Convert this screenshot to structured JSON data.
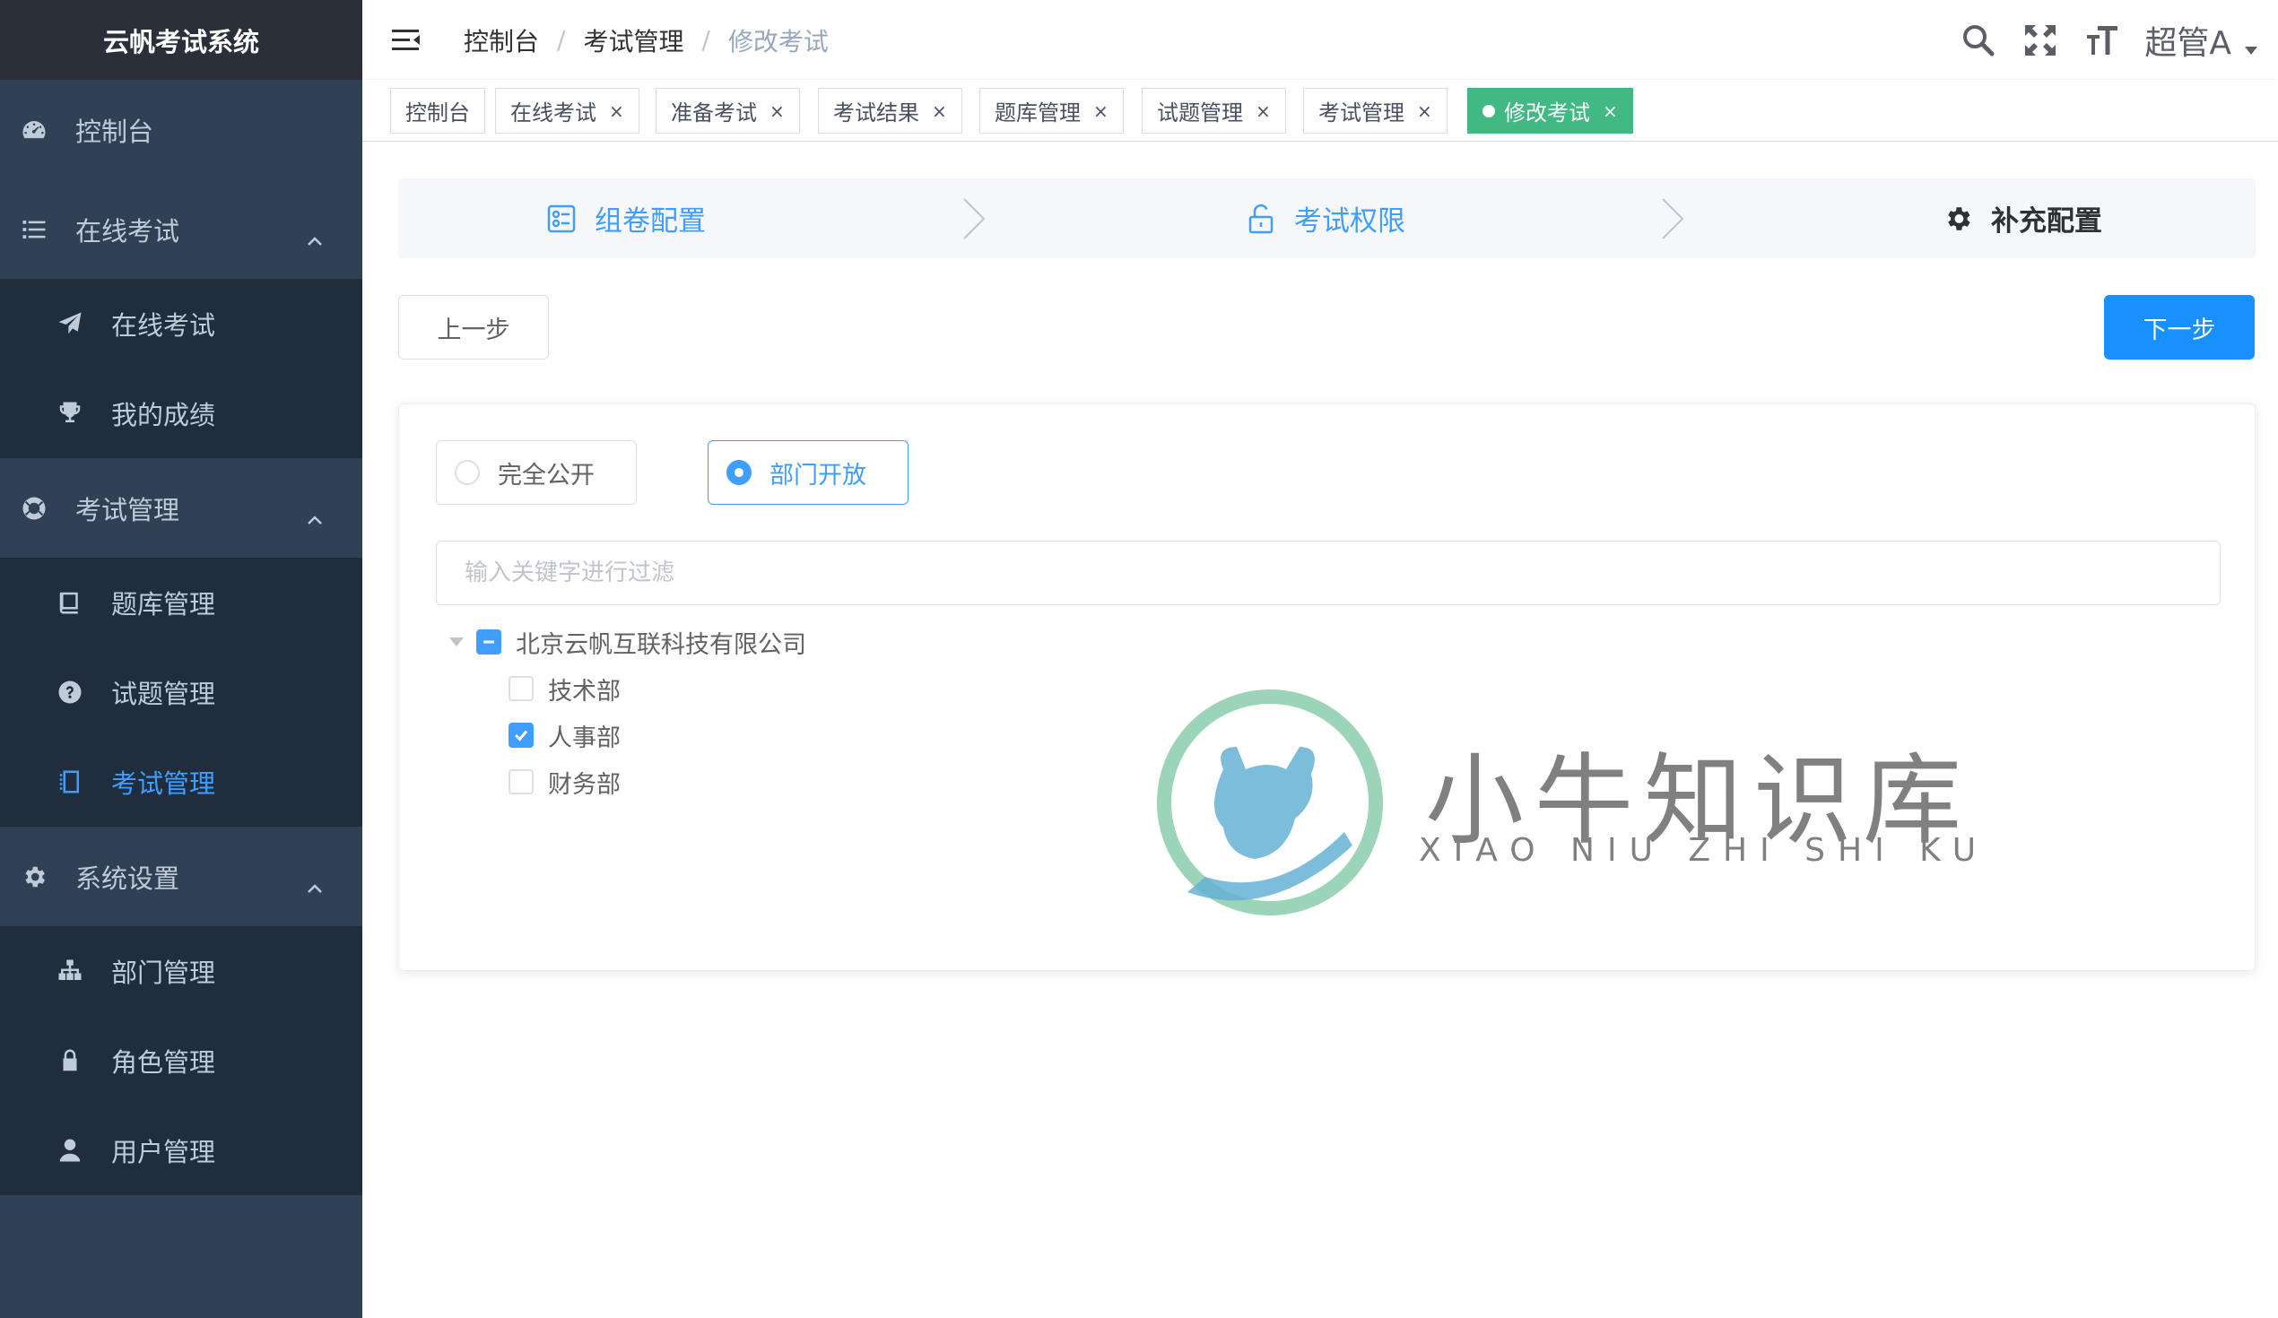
{
  "app": {
    "title": "云帆考试系统"
  },
  "sidebar": {
    "items": [
      {
        "label": "控制台",
        "icon": "dashboard-icon"
      },
      {
        "label": "在线考试",
        "icon": "list-icon"
      },
      {
        "label": "在线考试",
        "icon": "paper-plane-icon"
      },
      {
        "label": "我的成绩",
        "icon": "trophy-icon"
      },
      {
        "label": "考试管理",
        "icon": "lifebuoy-icon"
      },
      {
        "label": "题库管理",
        "icon": "book-icon"
      },
      {
        "label": "试题管理",
        "icon": "question-circle-icon"
      },
      {
        "label": "考试管理",
        "icon": "notebook-icon"
      },
      {
        "label": "系统设置",
        "icon": "gear-icon"
      },
      {
        "label": "部门管理",
        "icon": "sitemap-icon"
      },
      {
        "label": "角色管理",
        "icon": "lock-icon"
      },
      {
        "label": "用户管理",
        "icon": "user-icon"
      }
    ],
    "active_index": 7
  },
  "header": {
    "breadcrumb": [
      "控制台",
      "考试管理",
      "修改考试"
    ],
    "breadcrumb_separator": "/",
    "user_name": "超管A"
  },
  "tags": [
    {
      "label": "控制台",
      "closable": false
    },
    {
      "label": "在线考试",
      "closable": true
    },
    {
      "label": "准备考试",
      "closable": true
    },
    {
      "label": "考试结果",
      "closable": true
    },
    {
      "label": "题库管理",
      "closable": true
    },
    {
      "label": "试题管理",
      "closable": true
    },
    {
      "label": "考试管理",
      "closable": true
    },
    {
      "label": "修改考试",
      "closable": true,
      "active": true
    }
  ],
  "tag_close_glyph": "×",
  "steps": [
    {
      "label": "组卷配置",
      "status": "done"
    },
    {
      "label": "考试权限",
      "status": "done"
    },
    {
      "label": "补充配置",
      "status": "current"
    }
  ],
  "buttons": {
    "prev": "上一步",
    "next": "下一步"
  },
  "permission": {
    "options": [
      {
        "label": "完全公开",
        "checked": false
      },
      {
        "label": "部门开放",
        "checked": true
      }
    ]
  },
  "filter": {
    "placeholder": "输入关键字进行过滤",
    "value": ""
  },
  "tree": {
    "root": {
      "label": "北京云帆互联科技有限公司",
      "state": "indeterminate",
      "expanded": true
    },
    "children": [
      {
        "label": "技术部",
        "checked": false
      },
      {
        "label": "人事部",
        "checked": true
      },
      {
        "label": "财务部",
        "checked": false
      }
    ]
  },
  "watermark": {
    "title": "小牛知识库",
    "subtitle": "XIAO NIU ZHI SHI KU"
  },
  "colors": {
    "sidebar_bg": "#304156",
    "sidebar_sub_bg": "#1f2d3d",
    "primary": "#409eff",
    "tag_active": "#42b983",
    "next_button": "#1890ff"
  }
}
